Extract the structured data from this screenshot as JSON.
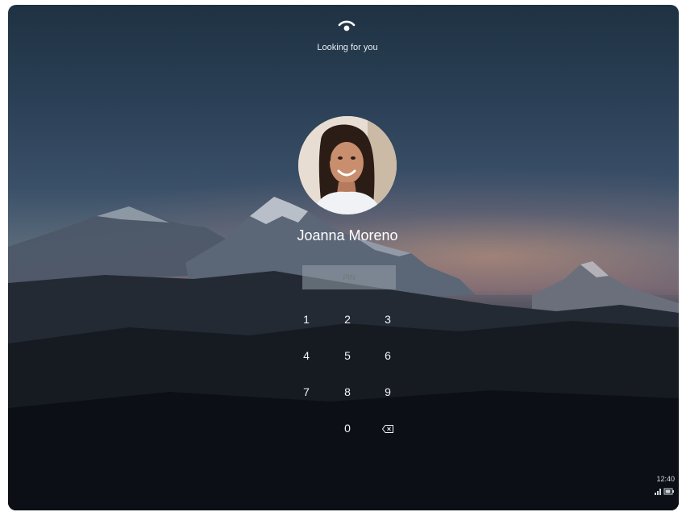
{
  "lock_screen": {
    "status_text": "Looking for you",
    "status_icon": "face-recognition-icon",
    "user_name": "Joanna Moreno",
    "pin_placeholder": "PIN",
    "keypad": {
      "keys": [
        "1",
        "2",
        "3",
        "4",
        "5",
        "6",
        "7",
        "8",
        "9",
        "0"
      ],
      "backspace_icon": "backspace-icon"
    }
  },
  "system_tray": {
    "time": "12:40",
    "icons": [
      "signal-icon",
      "battery-icon"
    ]
  },
  "colors": {
    "text": "#ffffff",
    "pin_field_bg": "#8e9aa6"
  }
}
